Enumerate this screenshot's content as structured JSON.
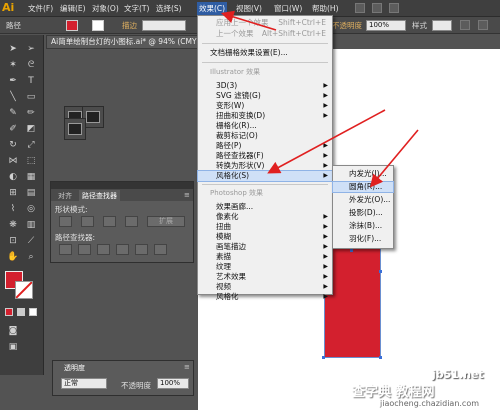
{
  "app": {
    "logo": "Ai"
  },
  "menubar": {
    "items": [
      "文件(F)",
      "编辑(E)",
      "对象(O)",
      "文字(T)",
      "选择(S)",
      "效果(C)",
      "视图(V)",
      "窗口(W)",
      "帮助(H)"
    ],
    "active": "效果(C)"
  },
  "control_bar": {
    "path_label": "路径",
    "stroke_label": "描边",
    "opacity_label": "不透明度",
    "opacity_value": "100%",
    "style_label": "样式"
  },
  "document": {
    "tab_title": "Ai简单绘制台灯的小图标.ai* @ 94% (CMYK"
  },
  "effect_menu": {
    "apply_last": {
      "label": "应用上一个效果",
      "shortcut": "Shift+Ctrl+E"
    },
    "last_effect": {
      "label": "上一个效果",
      "shortcut": "Alt+Shift+Ctrl+E"
    },
    "raster_settings": "文档栅格效果设置(E)...",
    "illustrator_header": "Illustrator 效果",
    "illustrator_items": [
      "3D(3)",
      "SVG 滤镜(G)",
      "变形(W)",
      "扭曲和变换(D)",
      "栅格化(R)...",
      "裁剪标记(O)",
      "路径(P)",
      "路径查找器(F)",
      "转换为形状(V)",
      "风格化(S)"
    ],
    "photoshop_header": "Photoshop 效果",
    "photoshop_items": [
      "效果画廊...",
      "像素化",
      "扭曲",
      "模糊",
      "画笔描边",
      "素描",
      "纹理",
      "艺术效果",
      "视频",
      "风格化"
    ]
  },
  "stylize_submenu": {
    "items": [
      "内发光(I)...",
      "圆角(R)...",
      "外发光(O)...",
      "投影(D)...",
      "涂抹(B)...",
      "羽化(F)..."
    ],
    "highlighted": "圆角(R)..."
  },
  "pathfinder_panel": {
    "tabs": [
      "对齐",
      "路径查找器"
    ],
    "shape_modes_label": "形状模式:",
    "pathfinders_label": "路径查找器:",
    "expand_label": "扩展"
  },
  "transparency_panel": {
    "tab": "透明度",
    "blend_mode": "正常",
    "opacity_label": "不透明度",
    "opacity_value": "100%"
  },
  "colors": {
    "accent": "#2f5da3",
    "shape_fill": "#d3202e",
    "annotation": "#e02020"
  },
  "watermark": {
    "site": "jb51.net",
    "cn": "查字典 教程网",
    "url": "jiaocheng.chazidian.com"
  }
}
